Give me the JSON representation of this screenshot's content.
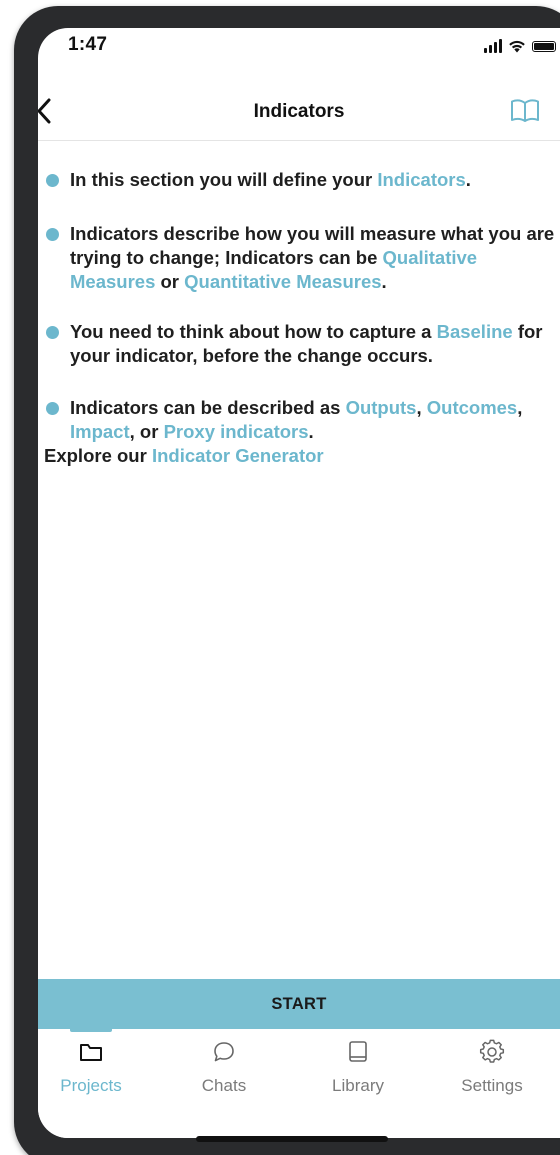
{
  "status_bar": {
    "time": "1:47"
  },
  "nav": {
    "title": "Indicators",
    "back_icon": "chevron-left-icon",
    "book_icon": "book-open-icon"
  },
  "bullets": [
    {
      "segments": [
        {
          "text": "In this section you will define your ",
          "link": false
        },
        {
          "text": "Indicators",
          "link": true
        },
        {
          "text": ".",
          "link": false
        }
      ]
    },
    {
      "segments": [
        {
          "text": "Indicators describe how you will measure what you are trying to change; Indicators can be ",
          "link": false
        },
        {
          "text": "Qualitative Measures",
          "link": true
        },
        {
          "text": " or ",
          "link": false
        },
        {
          "text": "Quantitative Measures",
          "link": true
        },
        {
          "text": ".",
          "link": false
        }
      ]
    },
    {
      "segments": [
        {
          "text": "You need to think about how to capture a ",
          "link": false
        },
        {
          "text": "Baseline",
          "link": true
        },
        {
          "text": " for your indicator, before the change occurs.",
          "link": false
        }
      ]
    },
    {
      "segments": [
        {
          "text": "Indicators can be described as ",
          "link": false
        },
        {
          "text": "Outputs",
          "link": true
        },
        {
          "text": ", ",
          "link": false
        },
        {
          "text": "Outcomes",
          "link": true
        },
        {
          "text": ", ",
          "link": false
        },
        {
          "text": "Impact",
          "link": true
        },
        {
          "text": ", or ",
          "link": false
        },
        {
          "text": "Proxy indicators",
          "link": true
        },
        {
          "text": ".",
          "link": false
        }
      ]
    }
  ],
  "explore": {
    "prefix": "Explore our ",
    "link": "Indicator Generator"
  },
  "start_button": {
    "label": "START"
  },
  "tabs": [
    {
      "label": "Projects",
      "icon": "folder-icon",
      "active": true
    },
    {
      "label": "Chats",
      "icon": "chat-bubble-icon",
      "active": false
    },
    {
      "label": "Library",
      "icon": "book-icon",
      "active": false
    },
    {
      "label": "Settings",
      "icon": "gear-icon",
      "active": false
    }
  ],
  "colors": {
    "accent": "#6cb7cd",
    "button": "#7abfd1",
    "text": "#1f1f1f",
    "tab_inactive": "#7b7b7b"
  }
}
